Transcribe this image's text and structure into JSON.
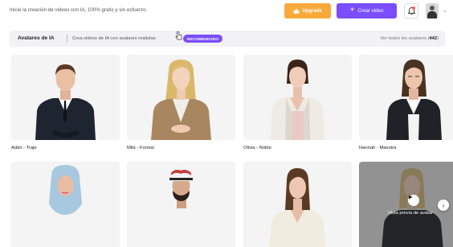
{
  "header": {
    "intro_text": "Inicie la creación de videos con IA, 100% gratis y sin esfuerzo.",
    "upgrade_label": "Upgrade",
    "create_label": "Crear video"
  },
  "section": {
    "title": "Avatares de IA",
    "subtitle": "Crea videos de IA con avatares realistas",
    "badge": "RECOMENDADO",
    "see_all_label": "Ver todos los avatares",
    "count": "442"
  },
  "avatars": [
    {
      "name": "Adán - Traje"
    },
    {
      "name": "Milá - Formal"
    },
    {
      "name": "Olivia - Noble"
    },
    {
      "name": "Hannah - Maestra"
    }
  ],
  "preview": {
    "label": "Vista previa de avatar"
  },
  "colors": {
    "accent": "#7b4dff",
    "upgrade": "#f7a93a"
  }
}
